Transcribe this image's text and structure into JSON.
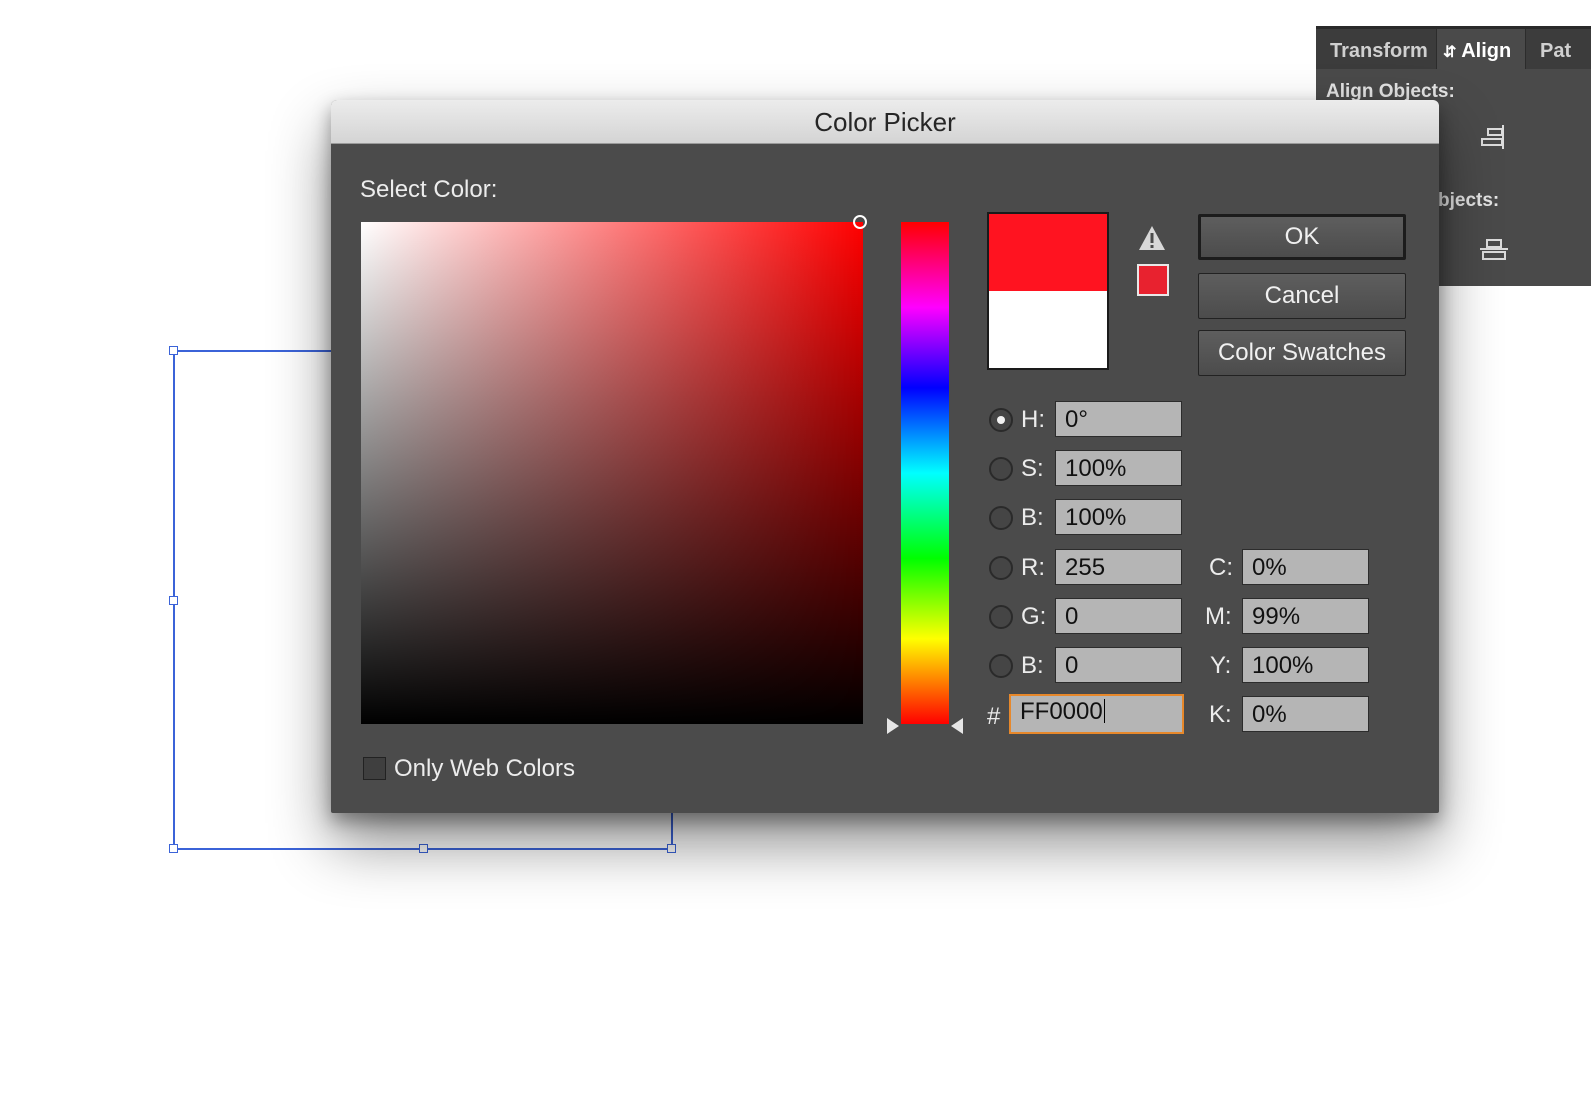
{
  "panel": {
    "tabs": [
      "Transform",
      "Align",
      "Pat"
    ],
    "align_objects_label": "Align Objects:",
    "distribute_objects_label": "bjects:"
  },
  "dialog": {
    "title": "Color Picker",
    "select_color_label": "Select Color:",
    "buttons": {
      "ok": "OK",
      "cancel": "Cancel",
      "swatches": "Color Swatches"
    },
    "new_color": "#ff1320",
    "current_color": "#ffffff",
    "gamut_color": "#e8222f",
    "fields": {
      "h": {
        "label": "H:",
        "value": "0°"
      },
      "s": {
        "label": "S:",
        "value": "100%"
      },
      "b": {
        "label": "B:",
        "value": "100%"
      },
      "r": {
        "label": "R:",
        "value": "255"
      },
      "g": {
        "label": "G:",
        "value": "0"
      },
      "b2": {
        "label": "B:",
        "value": "0"
      },
      "hex": {
        "label": "#",
        "value": "FF0000"
      },
      "c": {
        "label": "C:",
        "value": "0%"
      },
      "m": {
        "label": "M:",
        "value": "99%"
      },
      "y": {
        "label": "Y:",
        "value": "100%"
      },
      "k": {
        "label": "K:",
        "value": "0%"
      }
    },
    "only_web_colors_label": "Only Web Colors",
    "only_web_colors_checked": false
  }
}
